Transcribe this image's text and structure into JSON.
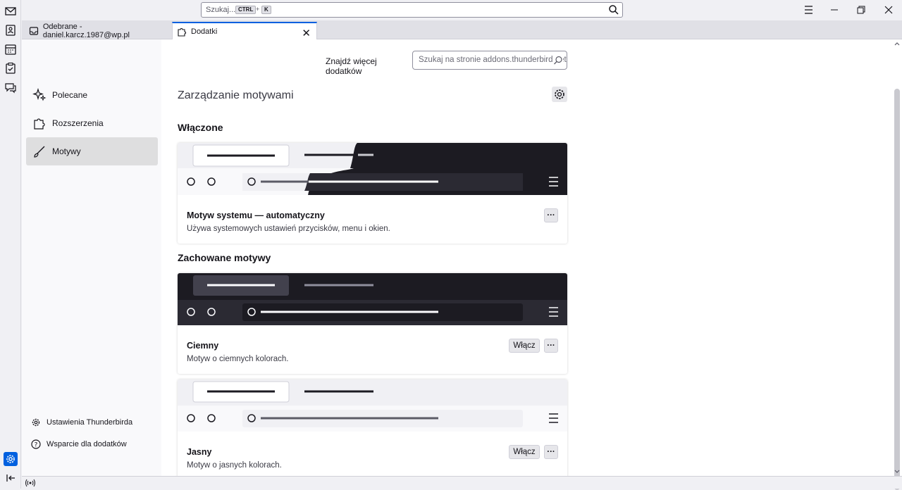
{
  "search": {
    "placeholder": "Szukaj...",
    "shortcut_key1": "CTRL",
    "shortcut_plus": "+",
    "shortcut_key2": "K"
  },
  "tabs": [
    {
      "label": "Odebrane - daniel.karcz.1987@wp.pl"
    },
    {
      "label": "Dodatki"
    }
  ],
  "sidebar": {
    "items": [
      {
        "label": "Polecane"
      },
      {
        "label": "Rozszerzenia"
      },
      {
        "label": "Motywy"
      }
    ],
    "footer": [
      {
        "label": "Ustawienia Thunderbirda"
      },
      {
        "label": "Wsparcie dla dodatków"
      }
    ]
  },
  "main": {
    "find_more_label": "Znajdź więcej dodatków",
    "addons_search_placeholder": "Szukaj na stronie addons.thunderbird.net",
    "title": "Zarządzanie motywami",
    "enabled_heading": "Włączone",
    "saved_heading": "Zachowane motywy",
    "enabled_theme": {
      "name": "Motyw systemu — automatyczny",
      "desc": "Używa systemowych ustawień przycisków, menu i okien."
    },
    "saved_themes": [
      {
        "name": "Ciemny",
        "desc": "Motyw o ciemnych kolorach.",
        "enable_label": "Włącz"
      },
      {
        "name": "Jasny",
        "desc": "Motyw o jasnych kolorach.",
        "enable_label": "Włącz"
      }
    ],
    "more_label": "···"
  },
  "colors": {
    "accent": "#0060df",
    "dark": "#1c1b22",
    "light": "#f0f0f4"
  }
}
